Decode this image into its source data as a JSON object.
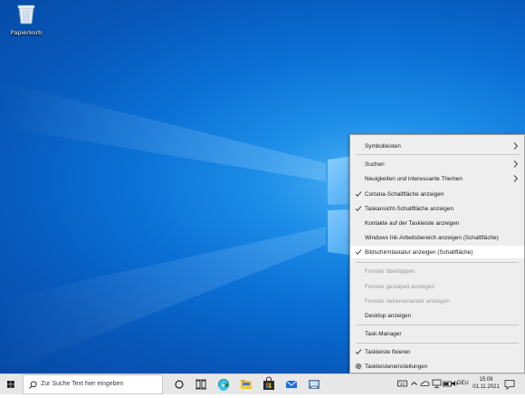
{
  "desktop": {
    "recycle_bin_label": "Papierkorb"
  },
  "context_menu": {
    "items": [
      {
        "label": "Symbolleisten",
        "checked": false,
        "disabled": false,
        "submenu": true
      },
      {
        "label": "Suchen",
        "checked": false,
        "disabled": false,
        "submenu": true
      },
      {
        "label": "Neuigkeiten und interessante Themen",
        "checked": false,
        "disabled": false,
        "submenu": true
      },
      {
        "label": "Cortana-Schaltfläche anzeigen",
        "checked": true,
        "disabled": false,
        "submenu": false
      },
      {
        "label": "Taskansicht-Schaltfläche anzeigen",
        "checked": true,
        "disabled": false,
        "submenu": false
      },
      {
        "label": "Kontakte auf der Taskleiste anzeigen",
        "checked": false,
        "disabled": false,
        "submenu": false
      },
      {
        "label": "Windows Ink-Arbeitsbereich anzeigen (Schaltfläche)",
        "checked": false,
        "disabled": false,
        "submenu": false
      },
      {
        "label": "Bildschirmtastatur anzeigen (Schaltfläche)",
        "checked": true,
        "disabled": false,
        "submenu": false,
        "highlighted": true
      },
      {
        "label": "Fenster überlappen",
        "checked": false,
        "disabled": true,
        "submenu": false
      },
      {
        "label": "Fenster gestapelt anzeigen",
        "checked": false,
        "disabled": true,
        "submenu": false
      },
      {
        "label": "Fenster nebeneinander anzeigen",
        "checked": false,
        "disabled": true,
        "submenu": false
      },
      {
        "label": "Desktop anzeigen",
        "checked": false,
        "disabled": false,
        "submenu": false
      },
      {
        "label": "Task-Manager",
        "checked": false,
        "disabled": false,
        "submenu": false
      },
      {
        "label": "Taskleiste fixieren",
        "checked": true,
        "disabled": false,
        "submenu": false
      },
      {
        "label": "Taskleisteneinstellungen",
        "checked": false,
        "disabled": false,
        "submenu": false,
        "icon": "gear-icon"
      }
    ]
  },
  "taskbar": {
    "search_placeholder": "Zur Suche Text hier eingeben",
    "language": "DEU",
    "time": "15:09",
    "date": "01.11.2021",
    "pinned_icons": [
      "cortana-icon",
      "task-view-icon",
      "edge-icon",
      "file-explorer-icon",
      "store-icon",
      "mail-icon",
      "app-icon"
    ],
    "tray_icons": [
      "touch-keyboard-icon",
      "chevron-up-icon",
      "onedrive-icon",
      "network-icon",
      "battery-icon",
      "volume-icon"
    ],
    "accent_color": "#0078d7"
  }
}
